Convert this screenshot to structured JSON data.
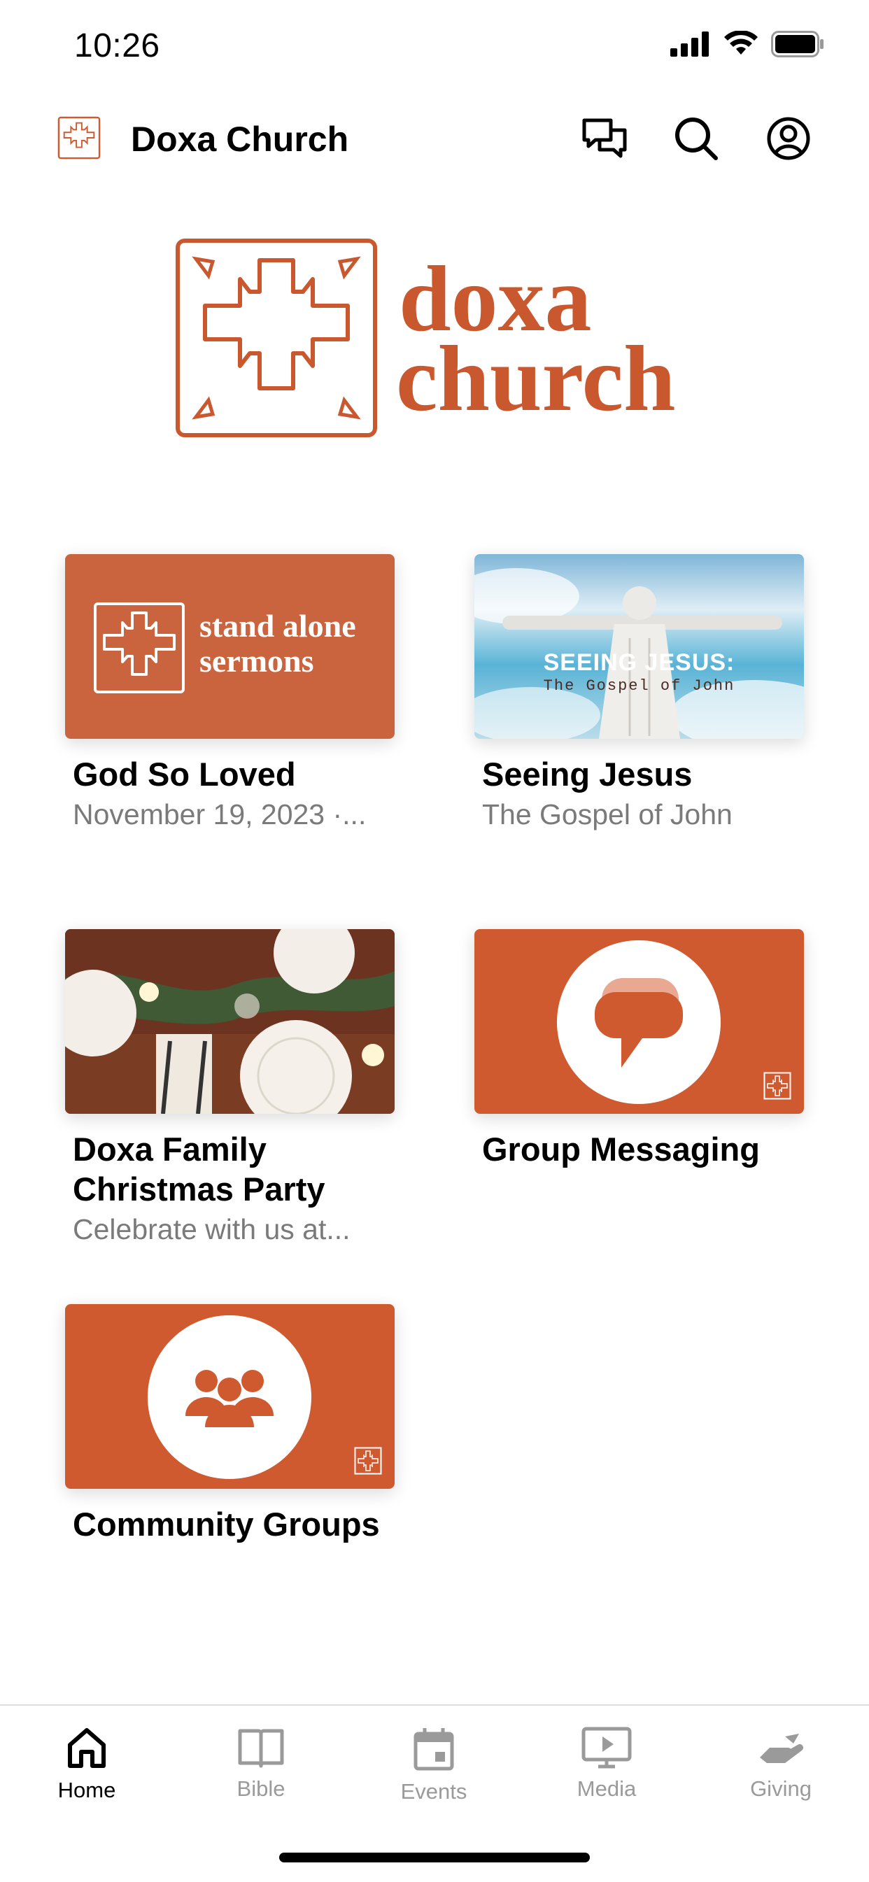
{
  "status_bar": {
    "time": "10:26"
  },
  "header": {
    "title": "Doxa Church"
  },
  "brand": {
    "line1": "doxa",
    "line2": "church",
    "color": "#c9582f"
  },
  "cards": [
    {
      "title": "God So Loved",
      "subtitle": "November 19, 2023 ·...",
      "thumb_text_1": "stand alone",
      "thumb_text_2": "sermons"
    },
    {
      "title": "Seeing Jesus",
      "subtitle": "The Gospel of John",
      "thumb_text_1": "SEEING JESUS:",
      "thumb_text_2": "The Gospel of John"
    },
    {
      "title": "Doxa Family Christmas Party",
      "subtitle": "Celebrate with us at..."
    },
    {
      "title": "Group Messaging"
    },
    {
      "title": "Community Groups"
    }
  ],
  "tabs": [
    {
      "label": "Home",
      "icon": "home-icon",
      "active": true
    },
    {
      "label": "Bible",
      "icon": "book-icon",
      "active": false
    },
    {
      "label": "Events",
      "icon": "calendar-icon",
      "active": false
    },
    {
      "label": "Media",
      "icon": "play-icon",
      "active": false
    },
    {
      "label": "Giving",
      "icon": "giving-hand-icon",
      "active": false
    }
  ],
  "colors": {
    "accent": "#d05a30",
    "inactive_tab": "#9a9a9a"
  }
}
